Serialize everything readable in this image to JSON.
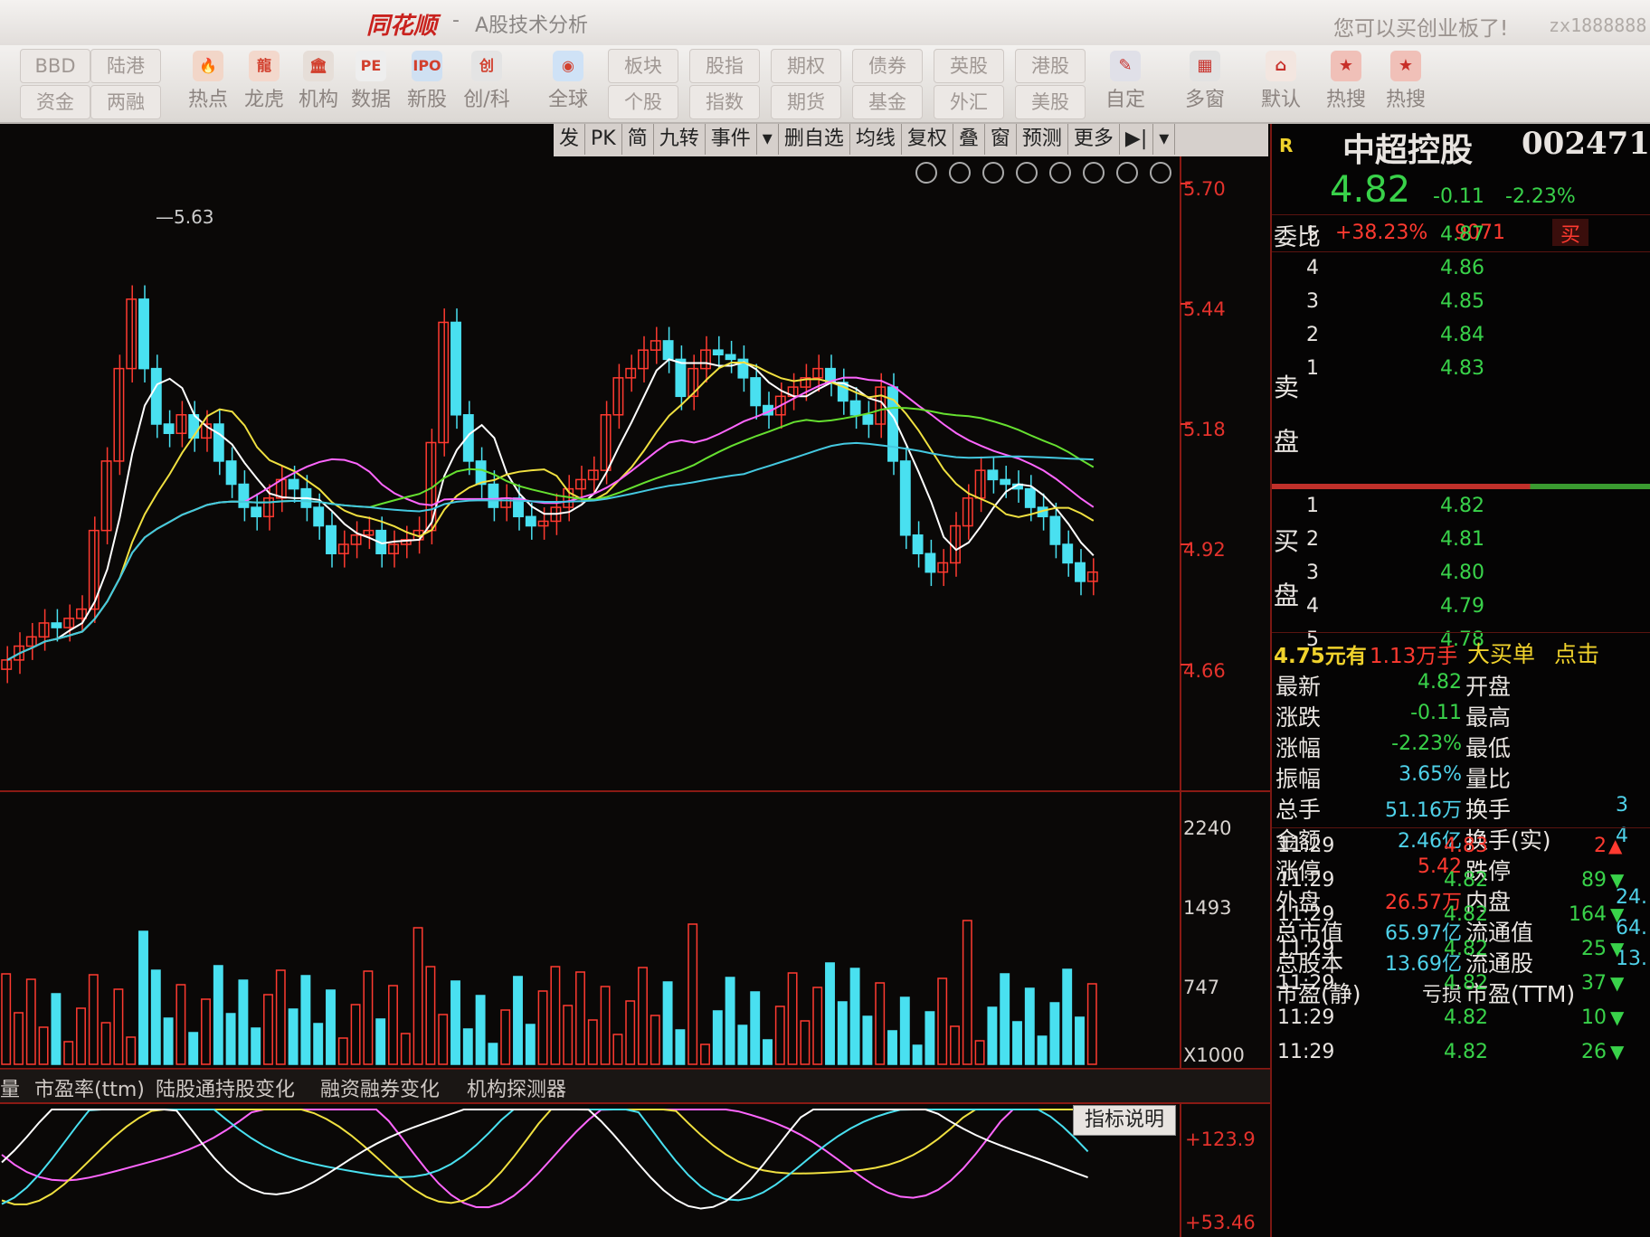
{
  "titlebar": {
    "app_name": "同花顺",
    "separator": "-",
    "module": "A股技术分析",
    "notice": "您可以买创业板了!",
    "user": "zx1888888"
  },
  "toolbar": {
    "stacks": [
      [
        "BBD",
        "资金"
      ],
      [
        "陆港",
        "两融"
      ]
    ],
    "icons": [
      {
        "label": "热点",
        "icon": "hot-icon"
      },
      {
        "label": "龙虎",
        "icon": "dragon-icon"
      },
      {
        "label": "机构",
        "icon": "institution-icon"
      },
      {
        "label": "数据",
        "icon": "pe-data-icon"
      },
      {
        "label": "新股",
        "icon": "ipo-icon"
      },
      {
        "label": "创/科",
        "icon": "chuang-icon"
      },
      {
        "label": "全球",
        "icon": "globe-icon"
      }
    ],
    "stacks2": [
      [
        "板块",
        "个股"
      ],
      [
        "股指",
        "指数"
      ],
      [
        "期权",
        "期货"
      ],
      [
        "债券",
        "基金"
      ],
      [
        "英股",
        "外汇"
      ],
      [
        "港股",
        "美股"
      ]
    ],
    "right": [
      {
        "label": "自定",
        "icon": "custom-icon"
      },
      {
        "label": "多窗",
        "icon": "multi-window-icon"
      },
      {
        "label": "默认",
        "icon": "home-icon"
      },
      {
        "label": "热搜",
        "icon": "hot-search-icon"
      },
      {
        "label": "热搜",
        "icon": "hot-search-icon-2"
      }
    ]
  },
  "chart_toolbar": [
    "发",
    "PK",
    "简",
    "九转",
    "事件",
    "▾",
    "删自选",
    "均线",
    "复权",
    "叠",
    "窗",
    "预测",
    "更多",
    "▶|",
    "▾"
  ],
  "price_axis": [
    "5.70",
    "5.44",
    "5.18",
    "4.92",
    "4.66"
  ],
  "high_mark": "5.63",
  "volume_axis": [
    "2240",
    "1493",
    "747",
    "X1000"
  ],
  "indicator_axis": [
    "+123.9",
    "+53.46"
  ],
  "indicator_tabs": [
    "量",
    "市盈率(ttm)",
    "陆股通持股变化",
    "融资融券变化",
    "机构探测器"
  ],
  "indicator_help": "指标说明",
  "quote": {
    "badge": "R",
    "name": "中超控股",
    "code": "002471",
    "price": "4.82",
    "change": "-0.11",
    "pct": "-2.23%",
    "weibi_label": "委比",
    "weibi": "+38.23%",
    "weicha": "9071",
    "buy_btn": "买",
    "sell_label": [
      "卖",
      "盘"
    ],
    "buy_label": [
      "买",
      "盘"
    ],
    "asks": [
      {
        "lvl": "5",
        "price": "4.87"
      },
      {
        "lvl": "4",
        "price": "4.86"
      },
      {
        "lvl": "3",
        "price": "4.85"
      },
      {
        "lvl": "2",
        "price": "4.84"
      },
      {
        "lvl": "1",
        "price": "4.83"
      }
    ],
    "bids": [
      {
        "lvl": "1",
        "price": "4.82"
      },
      {
        "lvl": "2",
        "price": "4.81"
      },
      {
        "lvl": "3",
        "price": "4.80"
      },
      {
        "lvl": "4",
        "price": "4.79"
      },
      {
        "lvl": "5",
        "price": "4.78"
      }
    ],
    "big_order": {
      "a": "4.75元有",
      "b": "1.13万手",
      "c": "大买单",
      "d": "点击"
    },
    "stats": [
      {
        "k1": "最新",
        "v1": "4.82",
        "c1": "g",
        "k2": "开盘",
        "v2": ""
      },
      {
        "k1": "涨跌",
        "v1": "-0.11",
        "c1": "g",
        "k2": "最高",
        "v2": ""
      },
      {
        "k1": "涨幅",
        "v1": "-2.23%",
        "c1": "g",
        "k2": "最低",
        "v2": ""
      },
      {
        "k1": "振幅",
        "v1": "3.65%",
        "c1": "c",
        "k2": "量比",
        "v2": ""
      },
      {
        "k1": "总手",
        "v1": "51.16万",
        "c1": "c",
        "k2": "换手",
        "v2": "3"
      },
      {
        "k1": "金额",
        "v1": "2.46亿",
        "c1": "c",
        "k2": "换手(实)",
        "v2": "4"
      },
      {
        "k1": "涨停",
        "v1": "5.42",
        "c1": "r",
        "k2": "跌停",
        "v2": ""
      },
      {
        "k1": "外盘",
        "v1": "26.57万",
        "c1": "r",
        "k2": "内盘",
        "v2": "24."
      },
      {
        "k1": "总市值",
        "v1": "65.97亿",
        "c1": "c",
        "k2": "流通值",
        "v2": "64."
      },
      {
        "k1": "总股本",
        "v1": "13.69亿",
        "c1": "c",
        "k2": "流通股",
        "v2": "13."
      },
      {
        "k1": "市盈(静)",
        "v1": "亏损",
        "c1": "w",
        "k2": "市盈(TTM)",
        "v2": ""
      }
    ],
    "ticks": [
      {
        "t": "11:29",
        "p": "4.83",
        "v": "2",
        "d": "up"
      },
      {
        "t": "11:29",
        "p": "4.82",
        "v": "89",
        "d": "down"
      },
      {
        "t": "11:29",
        "p": "4.82",
        "v": "164",
        "d": "down"
      },
      {
        "t": "11:29",
        "p": "4.82",
        "v": "25",
        "d": "down"
      },
      {
        "t": "11:29",
        "p": "4.82",
        "v": "37",
        "d": "down"
      },
      {
        "t": "11:29",
        "p": "4.82",
        "v": "10",
        "d": "down"
      },
      {
        "t": "11:29",
        "p": "4.82",
        "v": "26",
        "d": "down"
      }
    ]
  },
  "colors": {
    "up": "#ff3a30",
    "down": "#49e0f0",
    "ma5": "#ffffff",
    "ma10": "#f0e040",
    "ma20": "#ff66ff",
    "ma30": "#66e030",
    "ma60": "#44c8e0",
    "nine": "#ff60ff"
  }
}
